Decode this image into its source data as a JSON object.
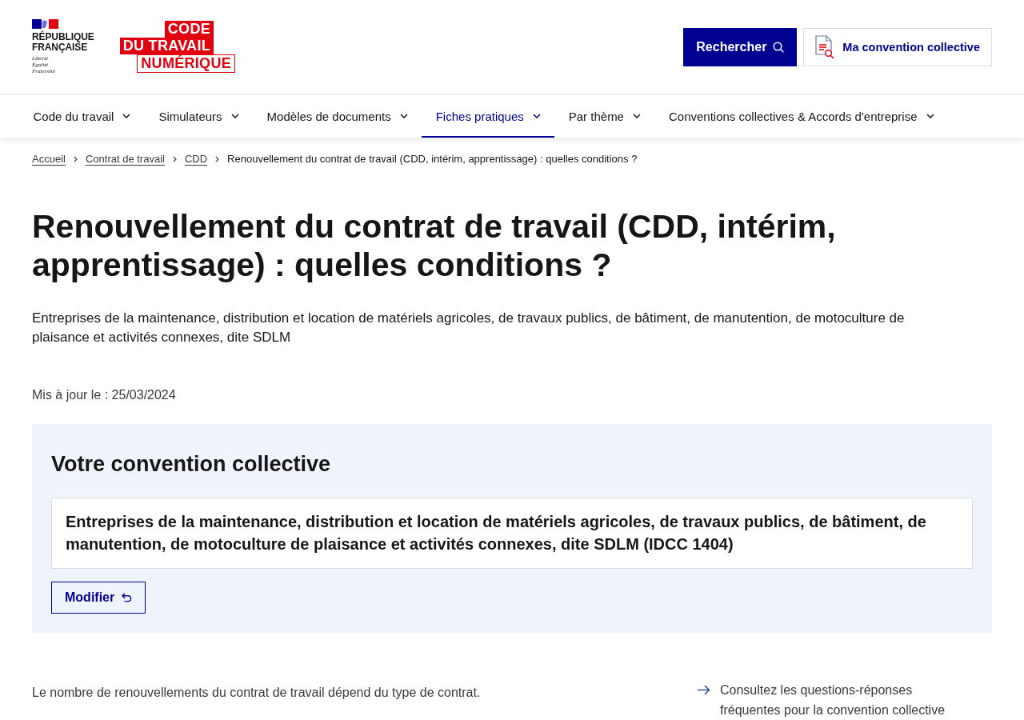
{
  "header": {
    "republic_name": "RÉPUBLIQUE FRANÇAISE",
    "motto": "Liberté Égalité Fraternité",
    "site_logo": [
      {
        "text": "CODE",
        "kind": "filled"
      },
      {
        "text": "DU TRAVAIL",
        "kind": "filled"
      },
      {
        "text": "NUMÉRIQUE",
        "kind": "outlined"
      }
    ],
    "search_button": "Rechercher",
    "convention_button": "Ma convention collective"
  },
  "nav": [
    {
      "label": "Code du travail",
      "selected": false
    },
    {
      "label": "Simulateurs",
      "selected": false
    },
    {
      "label": "Modèles de documents",
      "selected": false
    },
    {
      "label": "Fiches pratiques",
      "selected": true
    },
    {
      "label": "Par thème",
      "selected": false
    },
    {
      "label": "Conventions collectives & Accords d'entreprise",
      "selected": false
    }
  ],
  "breadcrumb": [
    {
      "label": "Accueil",
      "kind": "link"
    },
    {
      "label": "Contrat de travail",
      "kind": "link"
    },
    {
      "label": "CDD",
      "kind": "link"
    },
    {
      "label": "Renouvellement du contrat de travail (CDD, intérim, apprentissage) : quelles conditions ?",
      "kind": "current"
    }
  ],
  "title": "Renouvellement du contrat de travail (CDD, intérim, apprentissage) : quelles conditions ?",
  "subtitle": "Entreprises de la maintenance, distribution et location de matériels agricoles, de travaux publics, de bâtiment, de manutention, de motoculture de plaisance et activités connexes, dite SDLM",
  "updated": "Mis à jour le : 25/03/2024",
  "convention": {
    "heading": "Votre convention collective",
    "name": "Entreprises de la maintenance, distribution et location de matériels agricoles, de travaux publics, de bâtiment, de manutention, de motoculture de plaisance et activités connexes, dite SDLM (IDCC 1404)",
    "button": "Modifier"
  },
  "intro": "Le nombre de renouvellements du contrat de travail dépend du type de contrat.",
  "aside_link": "Consultez les questions-réponses fréquentes pour la convention collective"
}
